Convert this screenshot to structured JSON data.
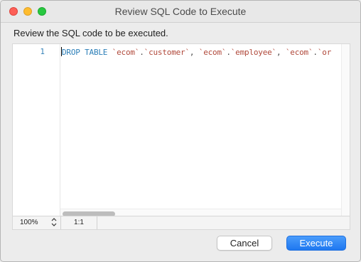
{
  "window": {
    "title": "Review SQL Code to Execute"
  },
  "instruction": "Review the SQL code to be executed.",
  "editor": {
    "line_number": "1",
    "code": {
      "kw_drop": "DROP TABLE",
      "t1": "`ecom`",
      "t1b": "`customer`",
      "t2": "`ecom`",
      "t2b": "`employee`",
      "t3": "`ecom`",
      "t3b": "`or",
      "dot": ".",
      "comma": ","
    }
  },
  "statusbar": {
    "zoom": "100%",
    "position": "1:1"
  },
  "buttons": {
    "cancel": "Cancel",
    "execute": "Execute"
  },
  "colors": {
    "keyword": "#2c7fb8",
    "string": "#b0483a",
    "line_number": "#3582b8",
    "primary_button": "#1f78f0"
  }
}
